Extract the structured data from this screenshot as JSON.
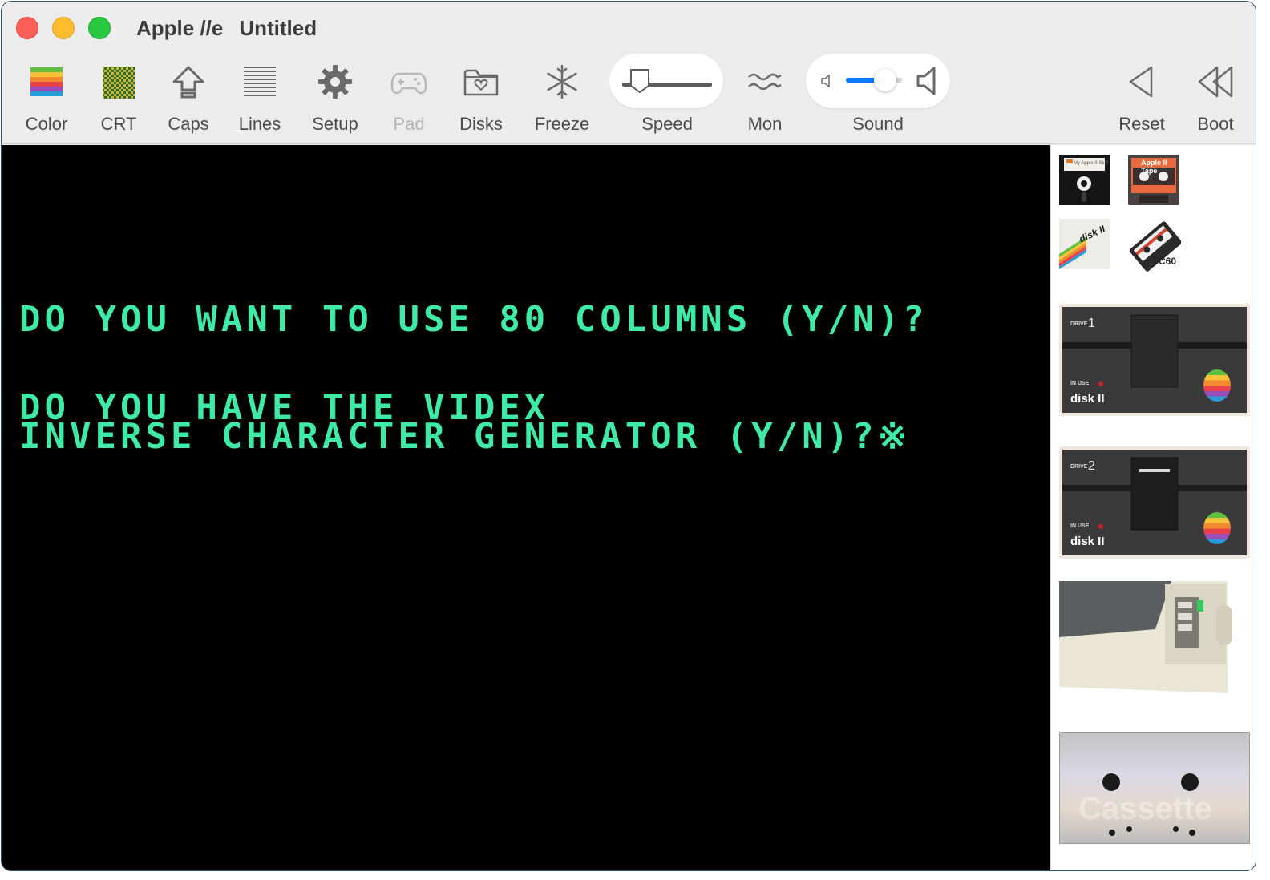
{
  "window": {
    "app_name": "Apple //e",
    "document_name": "Untitled"
  },
  "toolbar": {
    "color": "Color",
    "crt": "CRT",
    "caps": "Caps",
    "lines": "Lines",
    "setup": "Setup",
    "pad": "Pad",
    "disks": "Disks",
    "freeze": "Freeze",
    "speed": "Speed",
    "mon": "Mon",
    "sound": "Sound",
    "reset": "Reset",
    "boot": "Boot"
  },
  "controls": {
    "speed_level": 0.2,
    "sound_level": 0.7
  },
  "screen": {
    "lines": [
      "DO YOU WANT TO USE 80 COLUMNS (Y/N)?",
      "DO YOU HAVE THE VIDEX",
      "INVERSE CHARACTER GENERATOR (Y/N)?"
    ],
    "cursor": "※",
    "text_color": "#3fe9a6"
  },
  "sidebar": {
    "media": {
      "floppy_label": "My Apple II Stuff",
      "tape_label": "Apple II Tape",
      "disk_sleeve_label": "disk II",
      "cassette_label": "C60"
    },
    "drive1": {
      "drive_text": "DRIVE",
      "number": "1",
      "in_use": "IN USE",
      "brand": "disk II"
    },
    "drive2": {
      "drive_text": "DRIVE",
      "number": "2",
      "in_use": "IN USE",
      "brand": "disk II"
    },
    "cassette_deck": {
      "label": "Cassette"
    }
  }
}
